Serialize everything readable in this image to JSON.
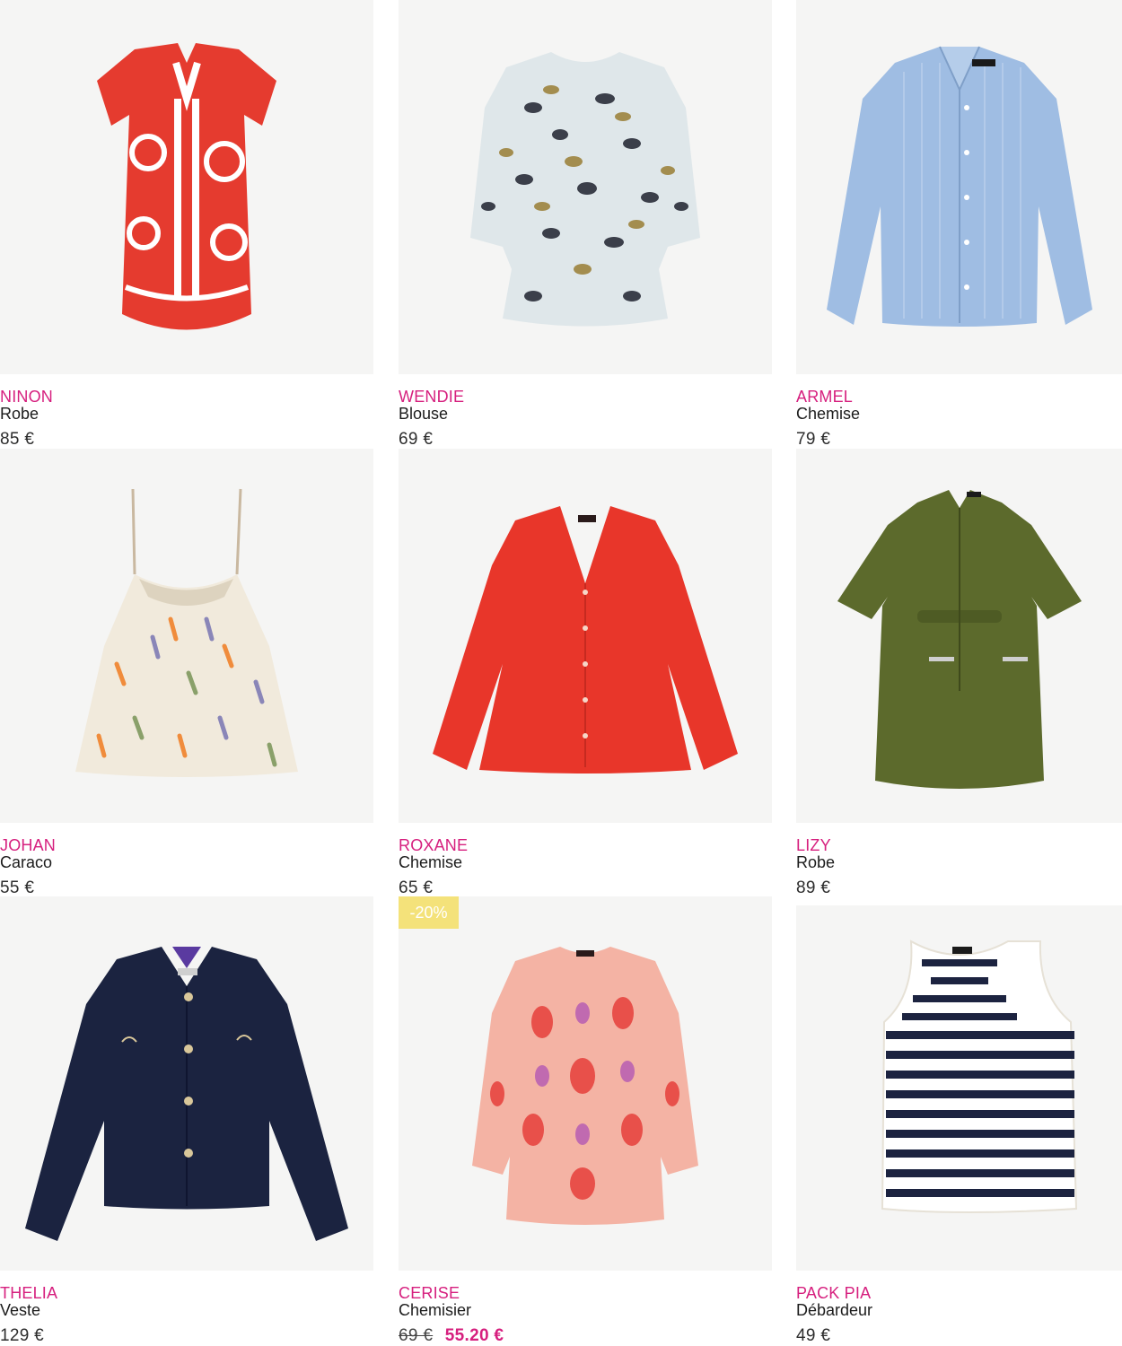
{
  "products": [
    {
      "brand": "NINON",
      "type": "Robe",
      "price": "85 €",
      "image_icon": "red-print-dress-image",
      "accent": "#e53b2f"
    },
    {
      "brand": "WENDIE",
      "type": "Blouse",
      "price": "69 €",
      "image_icon": "animal-print-blouse-image",
      "accent": "#9a8a5a"
    },
    {
      "brand": "ARMEL",
      "type": "Chemise",
      "price": "79 €",
      "image_icon": "blue-striped-shirt-image",
      "accent": "#9fbde3"
    },
    {
      "brand": "JOHAN",
      "type": "Caraco",
      "price": "55 €",
      "image_icon": "printed-cami-top-image",
      "accent": "#e8d9c2"
    },
    {
      "brand": "ROXANE",
      "type": "Chemise",
      "price": "65 €",
      "image_icon": "red-shirt-image",
      "accent": "#e8362a"
    },
    {
      "brand": "LIZY",
      "type": "Robe",
      "price": "89 €",
      "image_icon": "khaki-shirt-dress-image",
      "accent": "#5c6a2c"
    },
    {
      "brand": "THELIA",
      "type": "Veste",
      "price": "129 €",
      "image_icon": "navy-jacket-image",
      "accent": "#1b2340"
    },
    {
      "brand": "CERISE",
      "type": "Chemisier",
      "price_old": "69 €",
      "price_sale": "55.20 €",
      "badge": "-20%",
      "image_icon": "pink-ikat-blouse-image",
      "accent": "#e86a6a"
    },
    {
      "brand": "PACK PIA",
      "type": "Débardeur",
      "price": "49 €",
      "image_icon": "striped-tank-top-image",
      "accent": "#1c2340"
    }
  ]
}
